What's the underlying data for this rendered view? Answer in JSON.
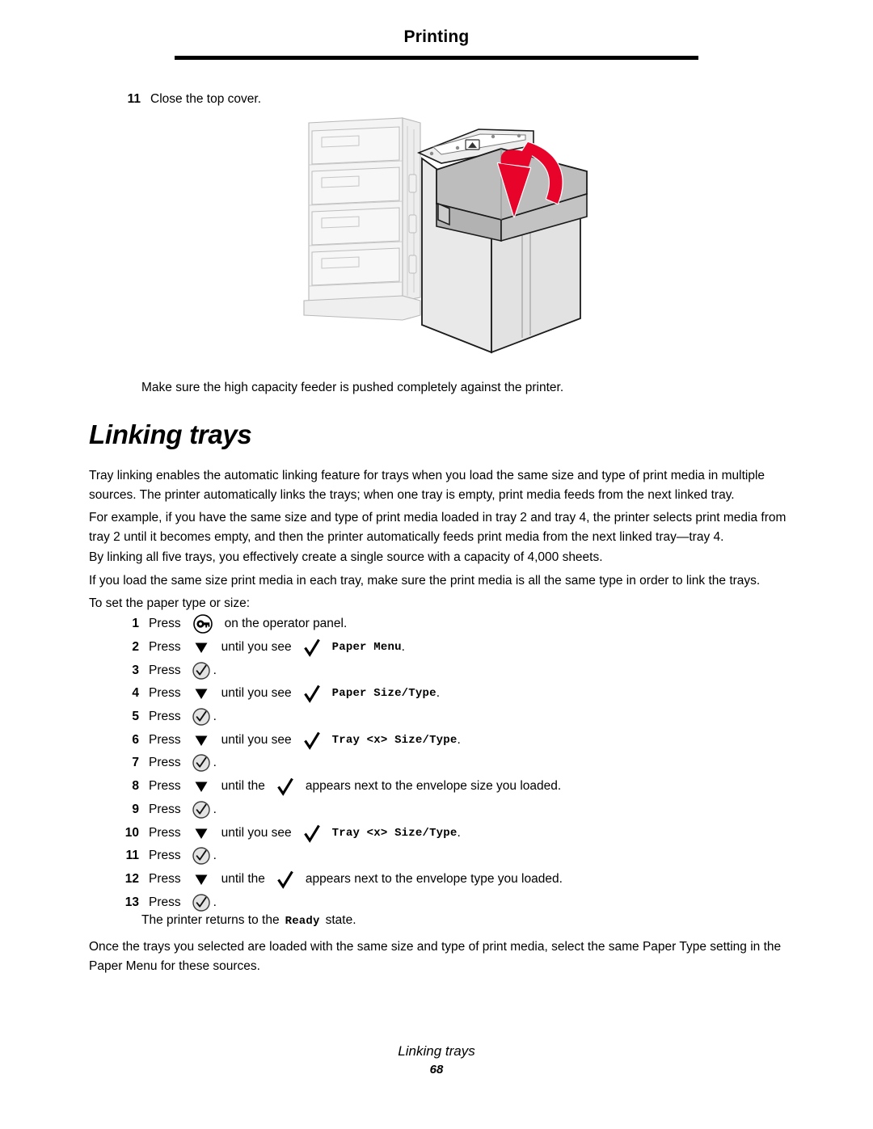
{
  "header": {
    "title": "Printing"
  },
  "top_step": {
    "number": "11",
    "text": "Close the top cover."
  },
  "illustration": {
    "name": "printer-with-high-capacity-feeder",
    "arrow_color": "#e8032b",
    "body_fill": "#e8e8e8",
    "cover_fill": "#bfbfbf",
    "tray_fill": "#f2f2f2"
  },
  "caption": "Make sure the high capacity feeder is pushed completely against the printer.",
  "section": {
    "heading": "Linking trays",
    "paragraphs": [
      "Tray linking enables the automatic linking feature for trays when you load the same size and type of print media in multiple sources. The printer automatically links the trays; when one tray is empty, print media feeds from the next linked tray.",
      "For example, if you have the same size and type of print media loaded in tray 2 and tray 4, the printer selects print media from tray 2 until it becomes empty, and then the printer automatically feeds print media from the next linked tray—tray 4.",
      "By linking all five trays, you effectively create a single source with a capacity of 4,000 sheets.",
      "If you load the same size print media in each tray, make sure the print media is all the same type in order to link the trays.",
      "To set the paper type or size:"
    ]
  },
  "steps": [
    {
      "number": "1",
      "press": "Press",
      "icon": "key-icon",
      "tail": "on the operator panel.",
      "mid": "",
      "check": "",
      "mono": "",
      "period": ""
    },
    {
      "number": "2",
      "press": "Press",
      "icon": "down-triangle-icon",
      "mid": "until you see",
      "check": "check-icon",
      "mono": "Paper Menu",
      "period": ".",
      "tail": ""
    },
    {
      "number": "3",
      "press": "Press",
      "icon": "check-circle-icon",
      "mid": "",
      "check": "",
      "mono": "",
      "period": ".",
      "tail": ""
    },
    {
      "number": "4",
      "press": "Press",
      "icon": "down-triangle-icon",
      "mid": "until you see",
      "check": "check-icon",
      "mono": "Paper Size/Type",
      "period": ".",
      "tail": ""
    },
    {
      "number": "5",
      "press": "Press",
      "icon": "check-circle-icon",
      "mid": "",
      "check": "",
      "mono": "",
      "period": ".",
      "tail": ""
    },
    {
      "number": "6",
      "press": "Press",
      "icon": "down-triangle-icon",
      "mid": "until you see",
      "check": "check-icon",
      "mono": "Tray <x> Size/Type",
      "period": ".",
      "tail": ""
    },
    {
      "number": "7",
      "press": "Press",
      "icon": "check-circle-icon",
      "mid": "",
      "check": "",
      "mono": "",
      "period": ".",
      "tail": ""
    },
    {
      "number": "8",
      "press": "Press",
      "icon": "down-triangle-icon",
      "mid": "until the",
      "check": "check-icon",
      "mono": "",
      "period": "",
      "tail": "appears next to the envelope size you loaded."
    },
    {
      "number": "9",
      "press": "Press",
      "icon": "check-circle-icon",
      "mid": "",
      "check": "",
      "mono": "",
      "period": ".",
      "tail": ""
    },
    {
      "number": "10",
      "press": "Press",
      "icon": "down-triangle-icon",
      "mid": "until you see",
      "check": "check-icon",
      "mono": "Tray <x> Size/Type",
      "period": ".",
      "tail": ""
    },
    {
      "number": "11",
      "press": "Press",
      "icon": "check-circle-icon",
      "mid": "",
      "check": "",
      "mono": "",
      "period": ".",
      "tail": ""
    },
    {
      "number": "12",
      "press": "Press",
      "icon": "down-triangle-icon",
      "mid": "until the",
      "check": "check-icon",
      "mono": "",
      "period": "",
      "tail": "appears next to the envelope type you loaded."
    },
    {
      "number": "13",
      "press": "Press",
      "icon": "check-circle-icon",
      "mid": "",
      "check": "",
      "mono": "",
      "period": ".",
      "tail": ""
    }
  ],
  "note": {
    "prefix": "The printer returns to the",
    "state": "Ready",
    "suffix": "state."
  },
  "closing_paragraph": "Once the trays you selected are loaded with the same size and type of print media, select the same Paper Type setting in the Paper Menu for these sources.",
  "footer": {
    "title": "Linking trays",
    "page": "68"
  }
}
